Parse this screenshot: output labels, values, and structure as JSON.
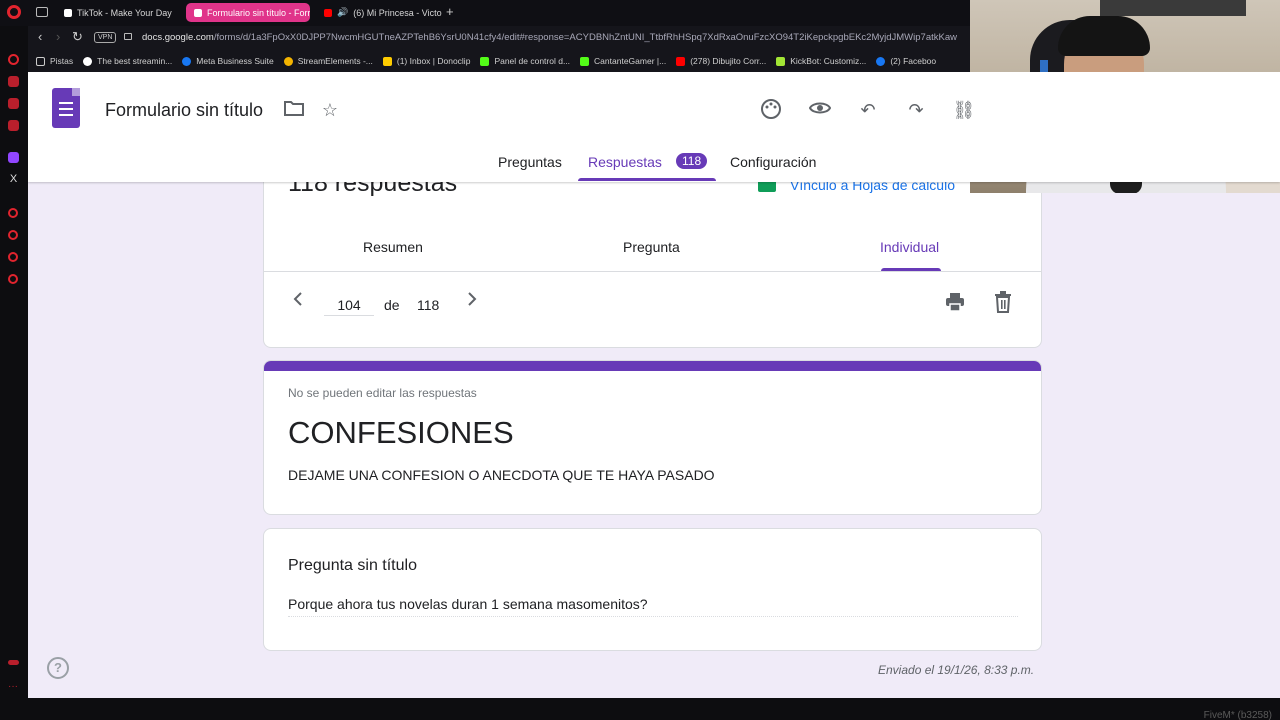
{
  "browser": {
    "tabs": [
      {
        "label": "TikTok - Make Your Day",
        "icon": "tiktok-icon",
        "color": "#ffffff"
      },
      {
        "label": "Formulario sin título - Forr",
        "icon": "google-forms-icon",
        "color": "#673ab7"
      },
      {
        "label": "(6) Mi Princesa - Victo",
        "icon": "youtube-icon",
        "color": "#ff0000"
      }
    ],
    "url_host": "docs.google.com",
    "url_path": "/forms/d/1a3FpOxX0DJPP7NwcmHGUTneAZPTehB6YsrU0N41cfy4/edit#response=ACYDBNhZntUNI_TtbfRhHSpq7XdRxaOnuFzcXO94T2iKepckpgbEKc2MyjdJMWip7atkKaw",
    "vpn_label": "VPN",
    "bookmarks": [
      {
        "label": "Pistas",
        "color": "#e5e5e5"
      },
      {
        "label": "The best streamin...",
        "color": "#ffffff"
      },
      {
        "label": "Meta Business Suite",
        "color": "#1877f2"
      },
      {
        "label": "StreamElements -...",
        "color": "#f4b400"
      },
      {
        "label": "(1) Inbox | Donoclip",
        "color": "#ffcc00"
      },
      {
        "label": "Panel de control d...",
        "color": "#53fc18"
      },
      {
        "label": "CantanteGamer |...",
        "color": "#53fc18"
      },
      {
        "label": "(278) Dibujito Corr...",
        "color": "#ff0000"
      },
      {
        "label": "KickBot: Customiz...",
        "color": "#a3e635"
      },
      {
        "label": "(2) Faceboo",
        "color": "#1877f2"
      }
    ]
  },
  "app": {
    "title": "Formulario sin título",
    "tabs": {
      "questions": "Preguntas",
      "responses": "Respuestas",
      "responses_count": "118",
      "settings": "Configuración"
    },
    "accent": "#673ab7"
  },
  "responses": {
    "count_label": "118 respuestas",
    "sheets_link": "Vínculo a Hojas de cálculo",
    "subtabs": {
      "summary": "Resumen",
      "question": "Pregunta",
      "individual": "Individual"
    },
    "pager": {
      "current": "104",
      "of_label": "de",
      "total": "118"
    }
  },
  "form": {
    "notice": "No se pueden editar las respuestas",
    "title": "CONFESIONES",
    "description": "DEJAME UNA CONFESION O ANECDOTA QUE TE HAYA PASADO"
  },
  "question": {
    "title": "Pregunta sin título",
    "answer": "Porque ahora tus novelas duran 1 semana masomenitos?"
  },
  "footer": {
    "sent": "Enviado el 19/1/26, 8:33 p.m.",
    "help": "?"
  },
  "status": {
    "fivem": "FiveM* (b3258)"
  }
}
